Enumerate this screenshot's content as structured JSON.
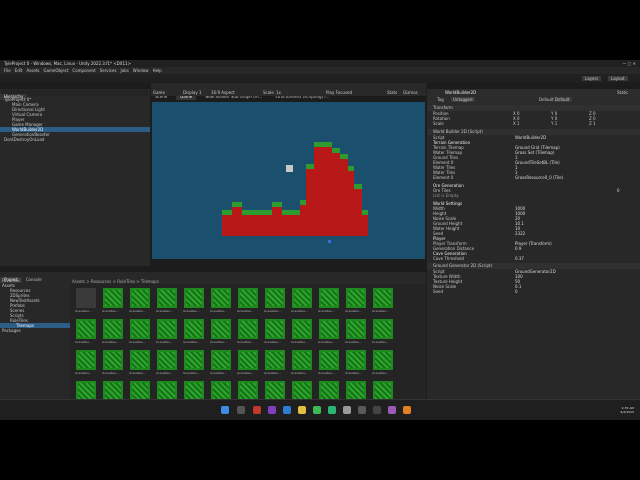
{
  "window": {
    "title": "TyleProject 0 - Windows, Mac, Linux - Unity 2022.3.f1* <DX11>"
  },
  "menu": [
    "File",
    "Edit",
    "Assets",
    "GameObject",
    "Component",
    "Services",
    "Jobs",
    "Window",
    "Help"
  ],
  "toolbar": {
    "layers_label": "Layers",
    "layout_label": "Layout"
  },
  "hierarchy": {
    "tab": "Hierarchy",
    "items": [
      {
        "label": "TyleProject 0*",
        "depth": 0
      },
      {
        "label": "Main Camera",
        "depth": 1
      },
      {
        "label": "Directional Light",
        "depth": 1
      },
      {
        "label": "Virtual Camera",
        "depth": 1
      },
      {
        "label": "Player",
        "depth": 1
      },
      {
        "label": "Game Manager",
        "depth": 1
      },
      {
        "label": "WorldBuilder2D",
        "depth": 1
      },
      {
        "label": "GenerationBooster",
        "depth": 1
      },
      {
        "label": "DontDestroyOnLoad",
        "depth": 0
      }
    ]
  },
  "scene_tabs": {
    "scene": "Scene",
    "game": "Game",
    "tab3": "New Shader Sub Graph (m...",
    "tab4": "structuretest (scripting) /..."
  },
  "game_toolbar": {
    "mode": "Game",
    "display": "Display 1",
    "aspect": "16:9 Aspect",
    "scale_label": "Scale",
    "scale_value": "1x",
    "play_focused": "Play Focused",
    "stats": "Stats",
    "gizmos": "Gizmos"
  },
  "project": {
    "tabs": [
      "Project",
      "Console"
    ],
    "tree": [
      "Favorites",
      "Assets",
      "Resources",
      "2DSprites",
      "NewTestAssets",
      "Prefabs",
      "Scenes",
      "Scripts",
      "RuleTiles",
      "Tilemaps",
      "Packages"
    ],
    "breadcrumb": "Assets > Resources > RuleTiles > Tilemaps",
    "asset_label": "GrassRes..."
  },
  "inspector": {
    "tabs": [
      "Inspector",
      "Lighting"
    ],
    "object_name": "WorldBuilder2D",
    "static_label": "Static",
    "tag_label": "Tag",
    "tag_value": "Untagged",
    "layer_label": "Layer",
    "layer_value": "Default",
    "transform": {
      "title": "Transform",
      "position": "Position",
      "rotation": "Rotation",
      "scale": "Scale",
      "pos": [
        "0",
        "0",
        "0"
      ],
      "rot": [
        "0",
        "0",
        "0"
      ],
      "scl": [
        "1",
        "1",
        "1"
      ]
    },
    "script": {
      "title": "World Builder 2D (Script)",
      "script_label": "Script",
      "script_value": "WorldBuilder2D"
    },
    "terrain": {
      "title": "Terrain Generation",
      "rows": [
        {
          "k": "Terrain Tilemap",
          "v": "Ground Grid (Tilemap)"
        },
        {
          "k": "Water Tilemap",
          "v": "Grass Set (Tilemap)"
        },
        {
          "k": "Ground Tiles",
          "v": "1"
        },
        {
          "k": "Element 0",
          "v": "GroundTileSetBL (Tile)"
        },
        {
          "k": "Water Tiles",
          "v": "1"
        },
        {
          "k": "Water Tiles",
          "v": "1"
        },
        {
          "k": "Element 0",
          "v": "GrassResource0_0 (Tile)"
        }
      ]
    },
    "ore": {
      "title": "Ore Generation",
      "ore_tiles": "Ore Tiles",
      "ore_tiles_v": "0",
      "list_empty": "List is Empty"
    },
    "world": {
      "title": "World Settings",
      "rows": [
        {
          "k": "Width",
          "v": "1000"
        },
        {
          "k": "Height",
          "v": "1000"
        },
        {
          "k": "Noise Scale",
          "v": "20"
        },
        {
          "k": "Ground Height",
          "v": "10.1"
        },
        {
          "k": "Water Height",
          "v": "10"
        },
        {
          "k": "Seed",
          "v": "2322"
        }
      ]
    },
    "player": {
      "title": "Player",
      "rows": [
        {
          "k": "Player Transform",
          "v": "Player (Transform)"
        },
        {
          "k": "Generation Distance",
          "v": "0.9"
        }
      ]
    },
    "cave": {
      "title": "Cave Generation",
      "rows": [
        {
          "k": "Cave Threshold",
          "v": "0.37"
        }
      ]
    },
    "ground": {
      "title": "Ground Generator 2D (Script)",
      "rows": [
        {
          "k": "Script",
          "v": "GroundGenerator2D"
        },
        {
          "k": "Texture Width",
          "v": "100"
        },
        {
          "k": "Texture Height",
          "v": "50"
        },
        {
          "k": "Noise Scale",
          "v": "0.1"
        },
        {
          "k": "Seed",
          "v": "0"
        }
      ]
    }
  },
  "taskbar": {
    "time": "9:35 AM",
    "date": "6/4/2025"
  },
  "colors": {
    "game_bg": "#1b4f6e",
    "dirt": "#b81818",
    "grass": "#2d9b2d",
    "accent": "#3d6ec6"
  }
}
